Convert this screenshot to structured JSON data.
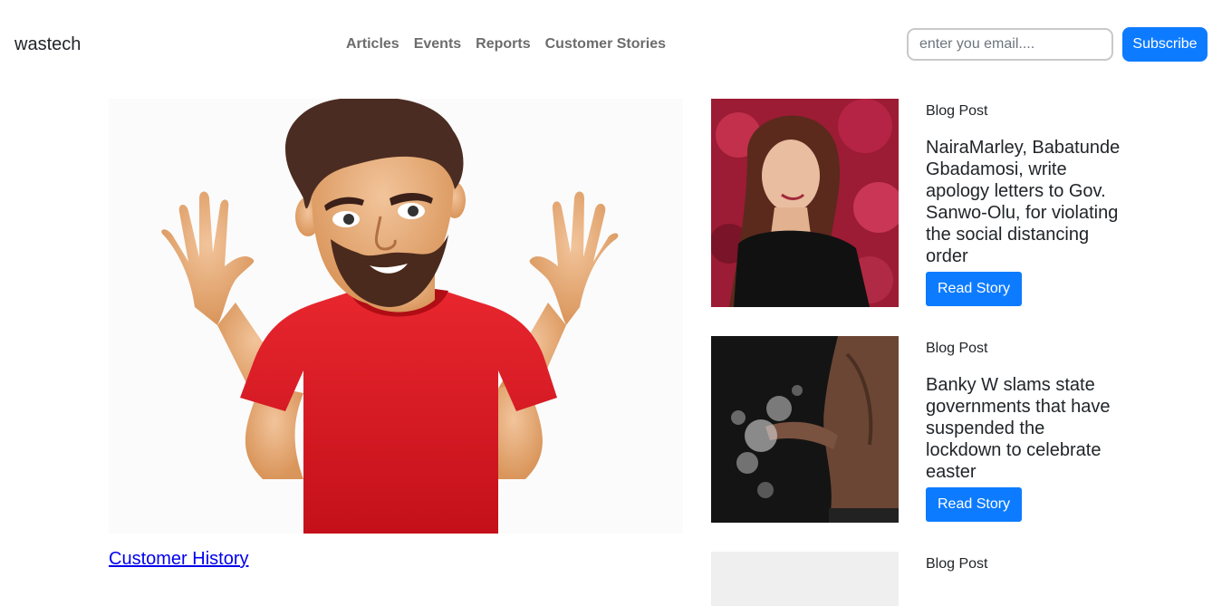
{
  "header": {
    "brand": "wastech",
    "nav": [
      "Articles",
      "Events",
      "Reports",
      "Customer Stories"
    ],
    "email_placeholder": "enter you email....",
    "subscribe_label": "Subscribe"
  },
  "hero": {
    "link_text": "Customer History"
  },
  "posts": [
    {
      "kicker": "Blog Post",
      "title": "NairaMarley, Babatunde Gbadamosi, write apology letters to Gov. Sanwo-Olu, for violating the social distancing order",
      "button": "Read Story"
    },
    {
      "kicker": "Blog Post",
      "title": "Banky W slams state governments that have suspended the lockdown to celebrate easter",
      "button": "Read Story"
    },
    {
      "kicker": "Blog Post"
    }
  ],
  "colors": {
    "primary": "#0d7bff",
    "nav_text": "#6c6c6c",
    "link": "#0000ee"
  }
}
